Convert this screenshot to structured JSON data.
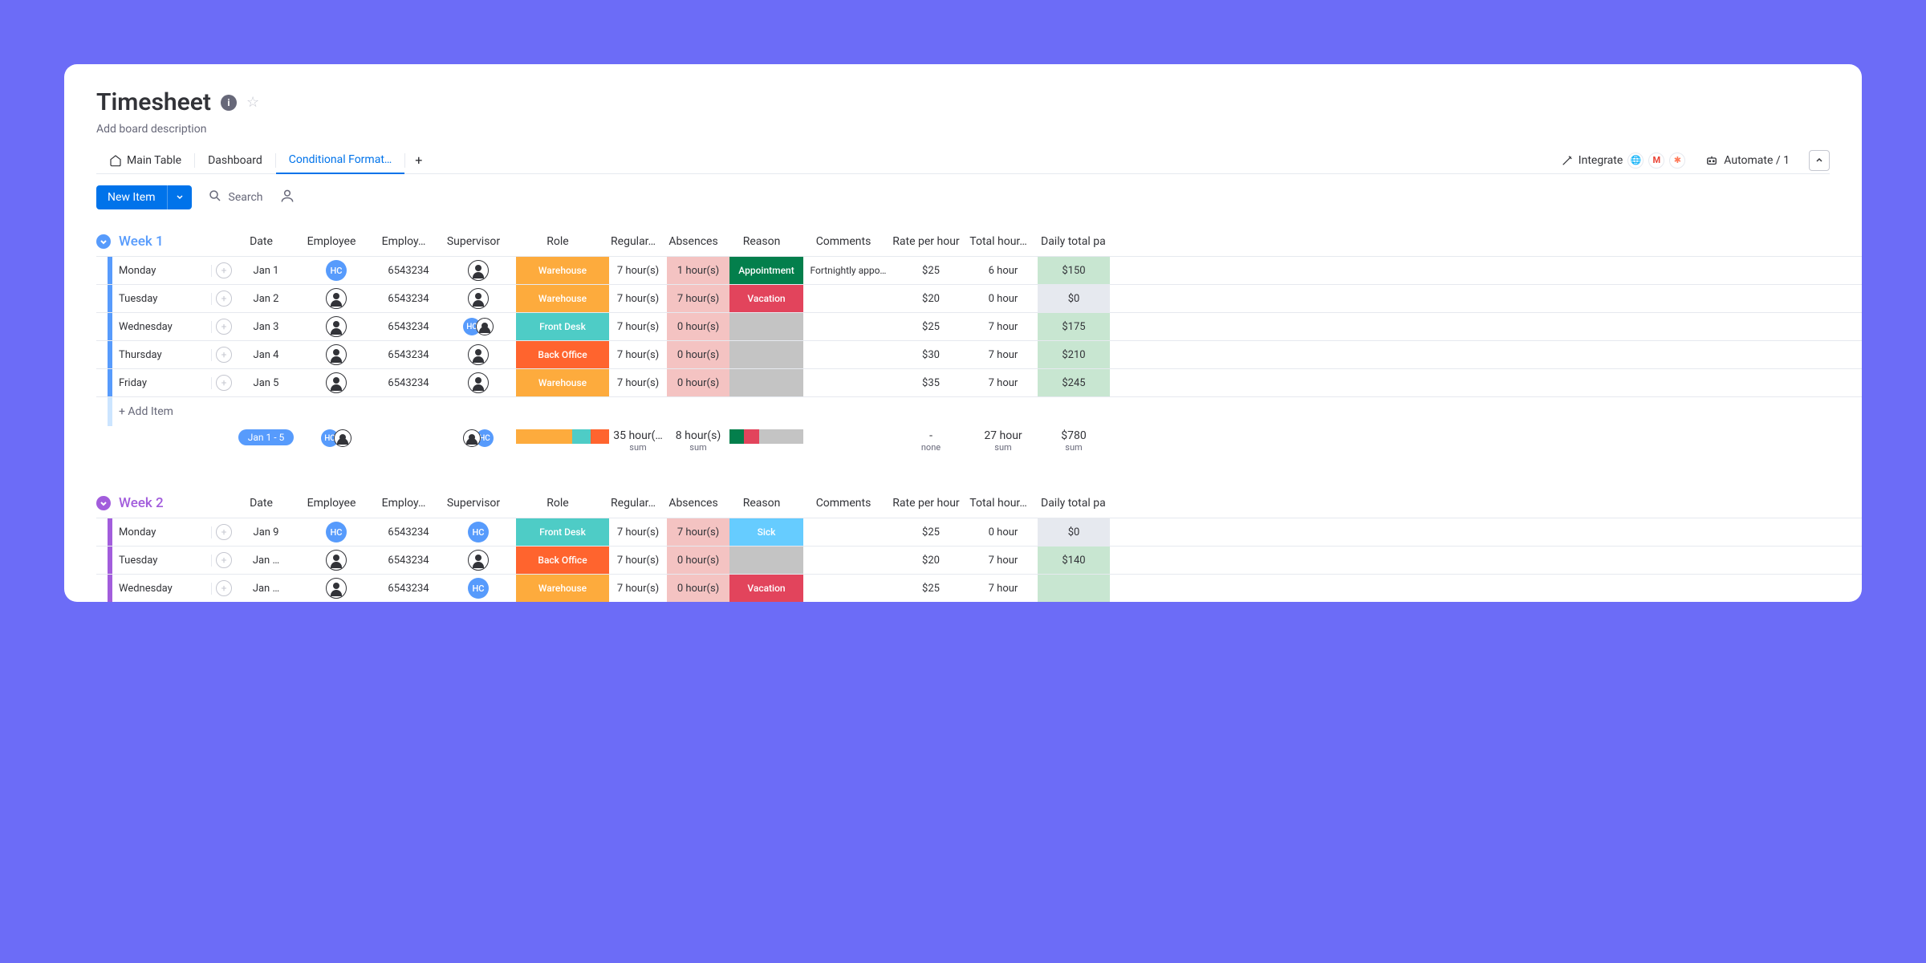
{
  "board": {
    "title": "Timesheet",
    "description": "Add board description"
  },
  "tabs": {
    "main": "Main Table",
    "dashboard": "Dashboard",
    "conditional": "Conditional Format…"
  },
  "toolbar": {
    "integrate": "Integrate",
    "automate": "Automate / 1",
    "new_item": "New Item",
    "search": "Search",
    "add_item": "+ Add Item"
  },
  "columns": {
    "date": "Date",
    "employee": "Employee",
    "employee_id": "Employ…",
    "supervisor": "Supervisor",
    "role": "Role",
    "regular": "Regular…",
    "absences": "Absences",
    "reason": "Reason",
    "comments": "Comments",
    "rate": "Rate per hour",
    "total": "Total hour…",
    "daily": "Daily total pa"
  },
  "week1": {
    "title": "Week 1",
    "rows": [
      {
        "day": "Monday",
        "date": "Jan 1",
        "emp": "hc",
        "empid": "6543234",
        "sup": "person",
        "role": "Warehouse",
        "roleClass": "role-warehouse",
        "reg": "7 hour(s)",
        "abs": "1 hour(s)",
        "reason": "Appointment",
        "reasonClass": "reason-appointment",
        "comm": "Fortnightly appo…",
        "rate": "$25",
        "total": "6 hour",
        "daily": "$150",
        "dailyClass": "daily-green"
      },
      {
        "day": "Tuesday",
        "date": "Jan 2",
        "emp": "person",
        "empid": "6543234",
        "sup": "person",
        "role": "Warehouse",
        "roleClass": "role-warehouse",
        "reg": "7 hour(s)",
        "abs": "7 hour(s)",
        "reason": "Vacation",
        "reasonClass": "reason-vacation",
        "comm": "",
        "rate": "$20",
        "total": "0 hour",
        "daily": "$0",
        "dailyClass": "daily-grey"
      },
      {
        "day": "Wednesday",
        "date": "Jan 3",
        "emp": "person",
        "empid": "6543234",
        "sup": "hc+person",
        "role": "Front Desk",
        "roleClass": "role-frontdesk",
        "reg": "7 hour(s)",
        "abs": "0 hour(s)",
        "reason": "",
        "reasonClass": "reason-empty",
        "comm": "",
        "rate": "$25",
        "total": "7 hour",
        "daily": "$175",
        "dailyClass": "daily-green"
      },
      {
        "day": "Thursday",
        "date": "Jan 4",
        "emp": "person",
        "empid": "6543234",
        "sup": "person",
        "role": "Back Office",
        "roleClass": "role-backoffice",
        "reg": "7 hour(s)",
        "abs": "0 hour(s)",
        "reason": "",
        "reasonClass": "reason-empty",
        "comm": "",
        "rate": "$30",
        "total": "7 hour",
        "daily": "$210",
        "dailyClass": "daily-green"
      },
      {
        "day": "Friday",
        "date": "Jan 5",
        "emp": "person",
        "empid": "6543234",
        "sup": "person",
        "role": "Warehouse",
        "roleClass": "role-warehouse",
        "reg": "7 hour(s)",
        "abs": "0 hour(s)",
        "reason": "",
        "reasonClass": "reason-empty",
        "comm": "",
        "rate": "$35",
        "total": "7 hour",
        "daily": "$245",
        "dailyClass": "daily-green"
      }
    ],
    "summary": {
      "dateRange": "Jan 1 - 5",
      "reg": "35 hour(…",
      "abs": "8 hour(s)",
      "sum": "sum",
      "rate": "-",
      "none": "none",
      "total": "27 hour",
      "daily": "$780"
    }
  },
  "week2": {
    "title": "Week 2",
    "rows": [
      {
        "day": "Monday",
        "date": "Jan 9",
        "emp": "hc",
        "empid": "6543234",
        "sup": "hc",
        "role": "Front Desk",
        "roleClass": "role-frontdesk",
        "reg": "7 hour(s)",
        "abs": "7 hour(s)",
        "reason": "Sick",
        "reasonClass": "reason-sick",
        "comm": "",
        "rate": "$25",
        "total": "0 hour",
        "daily": "$0",
        "dailyClass": "daily-grey"
      },
      {
        "day": "Tuesday",
        "date": "Jan …",
        "emp": "person",
        "empid": "6543234",
        "sup": "person",
        "role": "Back Office",
        "roleClass": "role-backoffice",
        "reg": "7 hour(s)",
        "abs": "0 hour(s)",
        "reason": "",
        "reasonClass": "reason-empty",
        "comm": "",
        "rate": "$20",
        "total": "7 hour",
        "daily": "$140",
        "dailyClass": "daily-green"
      },
      {
        "day": "Wednesday",
        "date": "Jan …",
        "emp": "person",
        "empid": "6543234",
        "sup": "hc",
        "role": "Warehouse",
        "roleClass": "role-warehouse",
        "reg": "7 hour(s)",
        "abs": "0 hour(s)",
        "reason": "Vacation",
        "reasonClass": "reason-vacation",
        "comm": "",
        "rate": "$25",
        "total": "7 hour",
        "daily": "",
        "dailyClass": "daily-green"
      }
    ]
  }
}
